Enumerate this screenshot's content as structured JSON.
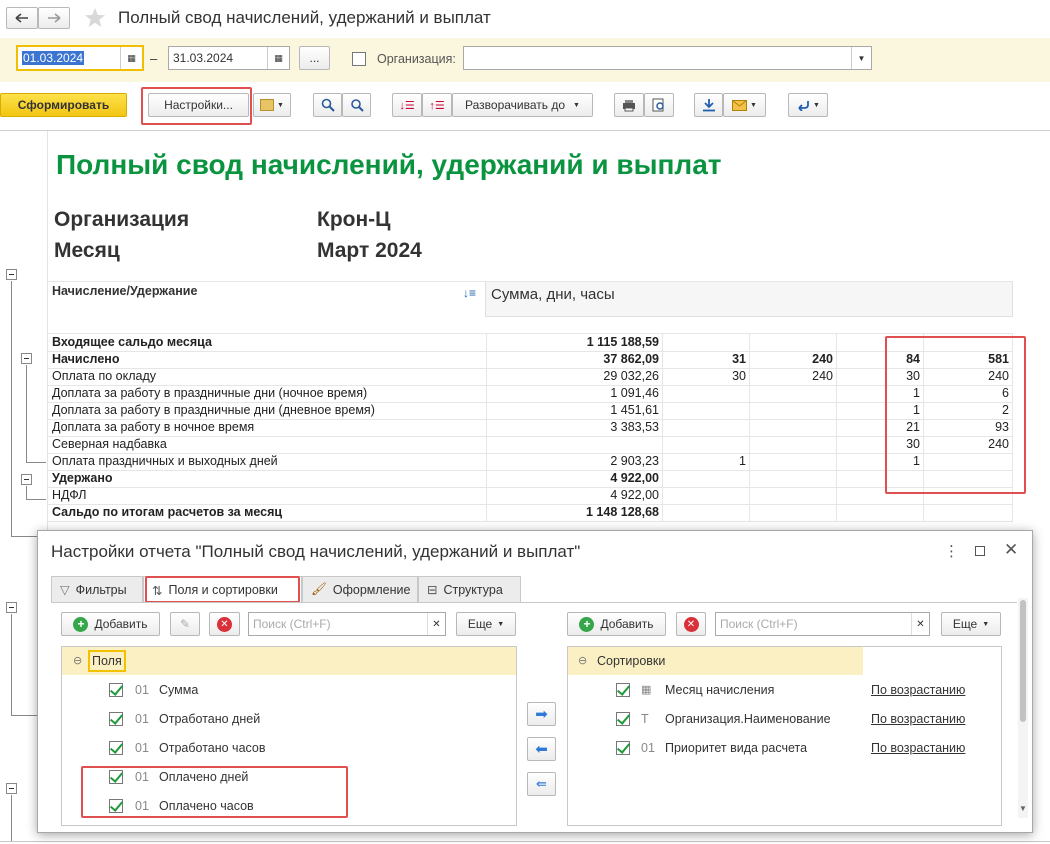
{
  "window": {
    "title": "Полный свод начислений, удержаний и выплат"
  },
  "params": {
    "date_from": "01.03.2024",
    "date_dash": "–",
    "date_to": "31.03.2024",
    "ellipsis": "...",
    "org_label": "Организация:",
    "org_value": ""
  },
  "toolbar": {
    "generate_label": "Сформировать",
    "settings_label": "Настройки...",
    "expand_label": "Разворачивать до"
  },
  "report": {
    "title": "Полный свод начислений, удержаний и выплат",
    "org_label": "Организация",
    "org_value": "Крон-Ц",
    "month_label": "Месяц",
    "month_value": "Март 2024",
    "col_header_1": "Начисление/Удержание",
    "col_header_2": "Сумма, дни, часы",
    "rows": [
      {
        "label": "Входящее сальдо месяца",
        "bold": true,
        "c1": "1 115 188,59",
        "c2": "",
        "c3": "",
        "c4": "",
        "c5": ""
      },
      {
        "label": "Начислено",
        "bold": true,
        "c1": "37 862,09",
        "c2": "31",
        "c3": "240",
        "c4": "84",
        "c5": "581"
      },
      {
        "label": "Оплата по окладу",
        "bold": false,
        "c1": "29 032,26",
        "c2": "30",
        "c3": "240",
        "c4": "30",
        "c5": "240"
      },
      {
        "label": "Доплата за работу в праздничные дни (ночное время)",
        "bold": false,
        "c1": "1 091,46",
        "c2": "",
        "c3": "",
        "c4": "1",
        "c5": "6"
      },
      {
        "label": "Доплата за работу в праздничные дни (дневное время)",
        "bold": false,
        "c1": "1 451,61",
        "c2": "",
        "c3": "",
        "c4": "1",
        "c5": "2"
      },
      {
        "label": "Доплата за работу в ночное время",
        "bold": false,
        "c1": "3 383,53",
        "c2": "",
        "c3": "",
        "c4": "21",
        "c5": "93"
      },
      {
        "label": "Северная надбавка",
        "bold": false,
        "c1": "",
        "c2": "",
        "c3": "",
        "c4": "30",
        "c5": "240"
      },
      {
        "label": "Оплата праздничных и выходных дней",
        "bold": false,
        "c1": "2 903,23",
        "c2": "1",
        "c3": "",
        "c4": "1",
        "c5": ""
      },
      {
        "label": "Удержано",
        "bold": true,
        "c1": "4 922,00",
        "c2": "",
        "c3": "",
        "c4": "",
        "c5": ""
      },
      {
        "label": "НДФЛ",
        "bold": false,
        "c1": "4 922,00",
        "c2": "",
        "c3": "",
        "c4": "",
        "c5": ""
      },
      {
        "label": "Сальдо по итогам расчетов за месяц",
        "bold": true,
        "c1": "1 148 128,68",
        "c2": "",
        "c3": "",
        "c4": "",
        "c5": ""
      }
    ]
  },
  "dialog": {
    "title": "Настройки отчета \"Полный свод начислений, удержаний и выплат\"",
    "tabs": [
      "Фильтры",
      "Поля и сортировки",
      "Оформление",
      "Структура"
    ],
    "left": {
      "add_label": "Добавить",
      "search_placeholder": "Поиск (Ctrl+F)",
      "more_label": "Еще",
      "group_label": "Поля",
      "items": [
        {
          "code": "01",
          "label": "Сумма"
        },
        {
          "code": "01",
          "label": "Отработано дней"
        },
        {
          "code": "01",
          "label": "Отработано часов"
        },
        {
          "code": "01",
          "label": "Оплачено дней"
        },
        {
          "code": "01",
          "label": "Оплачено часов"
        }
      ]
    },
    "right": {
      "add_label": "Добавить",
      "search_placeholder": "Поиск (Ctrl+F)",
      "more_label": "Еще",
      "group_label": "Сортировки",
      "items": [
        {
          "icon": "calendar-icon",
          "label": "Месяц начисления",
          "order": "По возрастанию"
        },
        {
          "icon": "T",
          "label": "Организация.Наименование",
          "order": "По возрастанию"
        },
        {
          "icon": "01",
          "label": "Приоритет вида расчета",
          "order": "По возрастанию"
        }
      ]
    }
  },
  "colors": {
    "report_title": "#0a9440",
    "accent_yellow": "#f5d31b",
    "highlight": "#e05050"
  }
}
